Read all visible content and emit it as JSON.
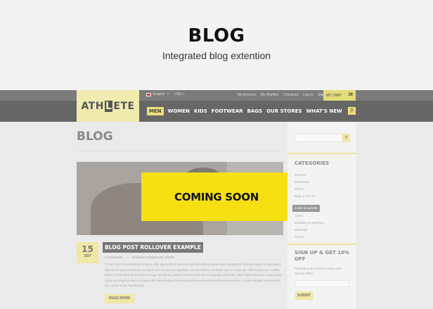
{
  "hero": {
    "title": "BLOG",
    "subtitle": "Integrated blog extention"
  },
  "topbar": {
    "language": "English",
    "currency": "USD",
    "links": [
      "My Account",
      "My Wishlist",
      "Checkout",
      "Log In",
      "Sign Up"
    ],
    "cart_label": "MY CART",
    "cart_count": "36"
  },
  "logo": {
    "part1": "ATH",
    "part2": "L",
    "part3": "ETE"
  },
  "nav": {
    "items": [
      "MEN",
      "WOMEN",
      "KIDS",
      "FOOTWEAR",
      "BAGS",
      "OUR STORES",
      "WHAT'S NEW"
    ]
  },
  "page": {
    "heading": "BLOG"
  },
  "post": {
    "overlay": "COMING SOON",
    "day": "15",
    "month": "SEP",
    "title": "BLOG POST ROLLOVER EXAMPLE",
    "comments": "2 Comments",
    "posted": "Posted in Features By Athlete",
    "excerpt": "At vero eos et accusamus et iusto odio dignissimos ducimus qui blanditiis praesentium voluptatum deleniti atque corrupti quos dolores et quas molestias excepturi sint occaecati cupiditate non provident, similique sunt in culpa qui officia deserunt mollitia animi, id est laborum et dolorum fuga. Et harum quidem rerum facilis est et expedita distinctio. Nam libero tempore, cum soluta nobis est eligendi optio cumque nihil impedit quo minus id quod maxime placeat facere possimus, omnis voluptas assumenda est, omnis dolor repellendus.",
    "read_more": "READ MORE"
  },
  "sidebar": {
    "categories_heading": "CATEGORIES",
    "categories": [
      "Dresses",
      "Swimwear",
      "Shoes",
      "Bags & Purces",
      "Coats & Jackets",
      "Jeans",
      "Jewellery & Watches",
      "Maternity",
      "Shorts"
    ],
    "signup_heading": "SIGN UP & GET 10% OFF",
    "signup_text": "Register your email for news and special offers",
    "submit": "SUBMIT"
  },
  "colors": {
    "accent_yellow": "#f6e012",
    "muted_yellow": "#efe7a4",
    "dark_bar": "#666666"
  }
}
